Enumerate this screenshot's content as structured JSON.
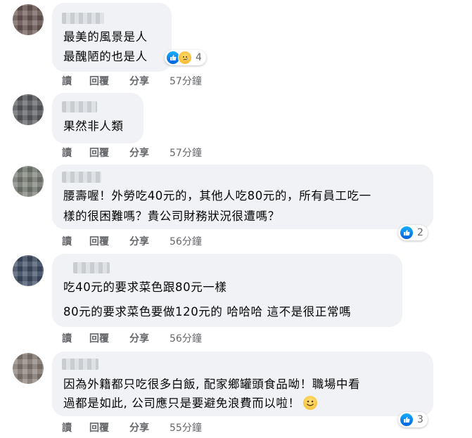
{
  "actions": {
    "read": "讀",
    "reply": "回覆",
    "share": "分享"
  },
  "comments": [
    {
      "lines": [
        "最美的風景是人",
        "最醜陋的也是人"
      ],
      "time": "57分鐘",
      "reaction_count": "4"
    },
    {
      "lines": [
        "果然非人類"
      ],
      "time": "57分鐘"
    },
    {
      "lines": [
        "腰壽喔！外勞吃40元的，其他人吃80元的，所有員工吃一",
        "樣的很困難嗎？貴公司財務狀況很遭嗎？"
      ],
      "time": "56分鐘",
      "reaction_count": "2"
    },
    {
      "lines": [
        "吃40元的要求菜色跟80元一樣",
        "80元的要求菜色要做120元的 哈哈哈 這不是很正常嗎"
      ],
      "time": "56分鐘"
    },
    {
      "lines": [
        "因為外籍都只吃很多白飯, 配家鄉罐頭食品呦！職場中看",
        "過都是如此, 公司應只是要避免浪費而以啦！"
      ],
      "time": "55分鐘",
      "reaction_count": "3"
    }
  ],
  "icons": {
    "like": "like-icon",
    "sad": "sad-icon",
    "smile": "smiley-emoji-icon"
  },
  "colors": {
    "bubble": "#f0f2f5",
    "like_blue": "#0571ed",
    "meta_gray": "#65676b"
  }
}
